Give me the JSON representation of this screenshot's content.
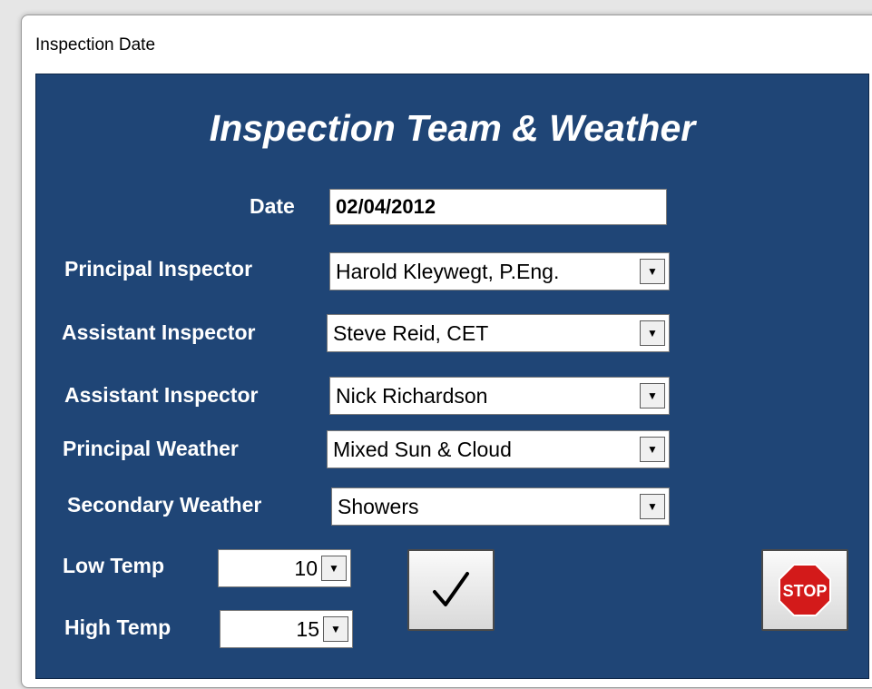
{
  "window": {
    "title": "Inspection Date"
  },
  "form": {
    "heading": "Inspection Team & Weather",
    "date": {
      "label": "Date",
      "value": "02/04/2012"
    },
    "principal_inspector": {
      "label": "Principal Inspector",
      "value": "Harold Kleywegt, P.Eng."
    },
    "assistant_inspector_1": {
      "label": "Assistant Inspector",
      "value": "Steve Reid, CET"
    },
    "assistant_inspector_2": {
      "label": "Assistant Inspector",
      "value": "Nick Richardson"
    },
    "principal_weather": {
      "label": "Principal Weather",
      "value": "Mixed Sun & Cloud"
    },
    "secondary_weather": {
      "label": "Secondary Weather",
      "value": "Showers"
    },
    "low_temp": {
      "label": "Low Temp",
      "value": "10"
    },
    "high_temp": {
      "label": "High Temp",
      "value": "15"
    }
  },
  "buttons": {
    "confirm": {
      "icon": "checkmark-icon"
    },
    "stop": {
      "icon": "stop-sign-icon",
      "text": "STOP"
    }
  },
  "colors": {
    "panel": "#1f4576",
    "stop": "#d31a1a"
  }
}
